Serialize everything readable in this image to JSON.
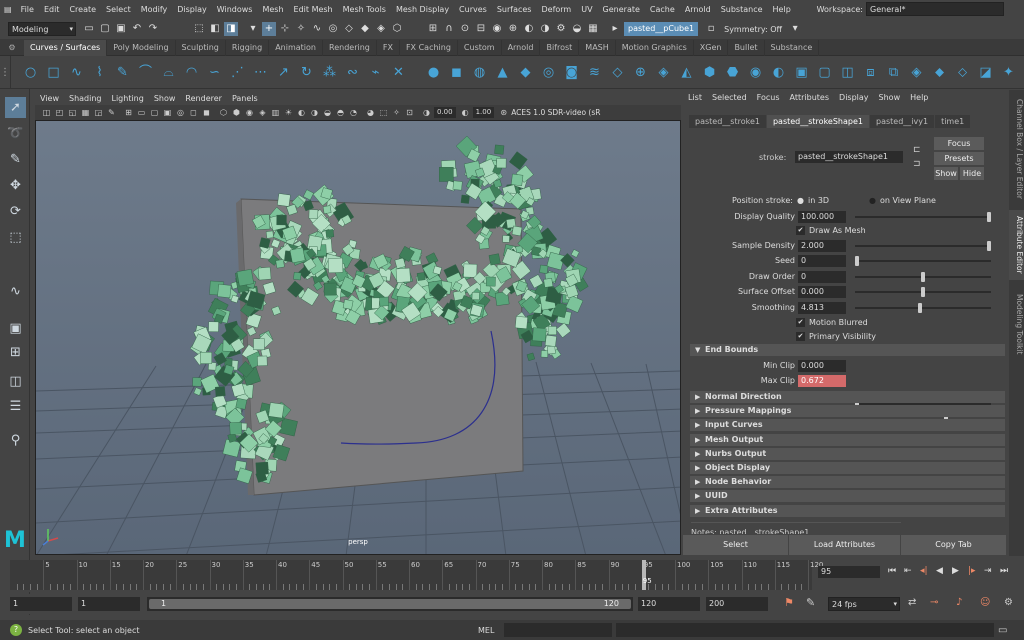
{
  "menu": [
    "File",
    "Edit",
    "Create",
    "Select",
    "Modify",
    "Display",
    "Windows",
    "Mesh",
    "Edit Mesh",
    "Mesh Tools",
    "Mesh Display",
    "Curves",
    "Surfaces",
    "Deform",
    "UV",
    "Generate",
    "Cache",
    "Arnold",
    "Substance",
    "Help"
  ],
  "workspace": {
    "label": "Workspace:",
    "value": "General*"
  },
  "toolbar": {
    "mode": "Modeling",
    "object_field": "pasted__pCube1",
    "symmetry": "Symmetry: Off"
  },
  "shelf_tabs": [
    "Curves / Surfaces",
    "Poly Modeling",
    "Sculpting",
    "Rigging",
    "Animation",
    "Rendering",
    "FX",
    "FX Caching",
    "Custom",
    "Arnold",
    "Bifrost",
    "MASH",
    "Motion Graphics",
    "XGen",
    "Bullet",
    "Substance"
  ],
  "shelf_active": "Curves / Surfaces",
  "viewport": {
    "menu": [
      "View",
      "Shading",
      "Lighting",
      "Show",
      "Renderer",
      "Panels"
    ],
    "exposure": "0.00",
    "gamma": "1.00",
    "colorspace": "ACES 1.0 SDR-video (sR",
    "camera_label": "persp"
  },
  "attribute_editor": {
    "menu": [
      "List",
      "Selected",
      "Focus",
      "Attributes",
      "Display",
      "Show",
      "Help"
    ],
    "tabs": [
      "pasted__stroke1",
      "pasted__strokeShape1",
      "pasted__ivy1",
      "time1"
    ],
    "active_tab": "pasted__strokeShape1",
    "node_label": "stroke:",
    "node_name": "pasted__strokeShape1",
    "buttons": {
      "focus": "Focus",
      "presets": "Presets",
      "show": "Show",
      "hide": "Hide"
    },
    "position_stroke": {
      "label": "Position stroke:",
      "opt1": "in 3D",
      "opt2": "on View Plane"
    },
    "display_quality": {
      "label": "Display Quality",
      "value": "100.000",
      "level": 1.0
    },
    "draw_as_mesh": "Draw As Mesh",
    "sample_density": {
      "label": "Sample Density",
      "value": "2.000",
      "level": 1.0
    },
    "seed": {
      "label": "Seed",
      "value": "0",
      "level": 0.0
    },
    "draw_order": {
      "label": "Draw Order",
      "value": "0",
      "level": 0.5
    },
    "surface_offset": {
      "label": "Surface Offset",
      "value": "0.000",
      "level": 0.5
    },
    "smoothing": {
      "label": "Smoothing",
      "value": "4.813",
      "level": 0.48
    },
    "motion_blurred": "Motion Blurred",
    "primary_visibility": "Primary Visibility",
    "end_bounds": {
      "title": "End Bounds",
      "min_label": "Min Clip",
      "min_value": "0.000",
      "min_level": 0.0,
      "max_label": "Max Clip",
      "max_value": "0.672",
      "max_level": 0.672
    },
    "sections": [
      "Normal Direction",
      "Pressure Mappings",
      "Input Curves",
      "Mesh Output",
      "Nurbs Output",
      "Object Display",
      "Node Behavior",
      "UUID",
      "Extra Attributes"
    ],
    "notes": "Notes: pasted__strokeShape1",
    "bottom_buttons": [
      "Select",
      "Load Attributes",
      "Copy Tab"
    ]
  },
  "side_tabs": [
    "Channel Box / Layer Editor",
    "Attribute Editor",
    "Modeling Toolkit"
  ],
  "timeline": {
    "ticks": [
      5,
      10,
      15,
      20,
      25,
      30,
      35,
      40,
      45,
      50,
      55,
      60,
      65,
      70,
      75,
      80,
      85,
      90,
      95,
      100,
      105,
      110,
      115,
      120
    ],
    "current_frame": "95",
    "current_value": 95,
    "max_frame": 120
  },
  "range": {
    "start": "1",
    "start2": "1",
    "inner_start": "1",
    "inner_end": "120",
    "end": "120",
    "end2": "200",
    "fps": "24 fps"
  },
  "status": {
    "help": "Select Tool: select an object",
    "lang": "MEL"
  },
  "colors": {
    "accent": "#5d7e99",
    "shelf_icon": "#48a4d6",
    "max_clip": "#d46a6a",
    "maya_logo": "#1ec3d6"
  }
}
